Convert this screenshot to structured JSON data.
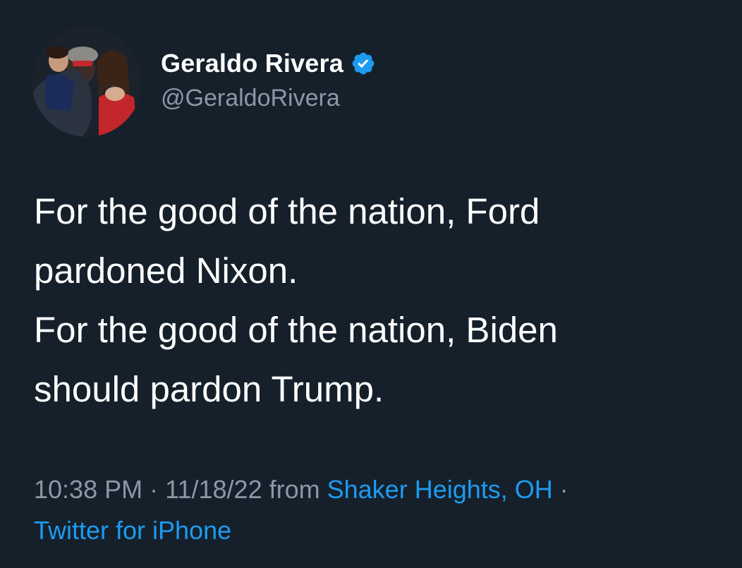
{
  "author": {
    "display_name": "Geraldo Rivera",
    "handle": "@GeraldoRivera",
    "verified": true,
    "avatar_icon": "profile-photo"
  },
  "tweet": {
    "lines": [
      "For the good of the nation, Ford",
      "pardoned Nixon.",
      "For the good of the nation, Biden",
      "should pardon Trump."
    ]
  },
  "meta": {
    "time": "10:38 PM",
    "separator": "·",
    "date": "11/18/22",
    "from_label": "from",
    "location": "Shaker Heights, OH",
    "source": "Twitter for iPhone"
  },
  "colors": {
    "background": "#15202b",
    "text": "#ffffff",
    "muted": "#8b98a5",
    "accent": "#1d9bf0"
  }
}
